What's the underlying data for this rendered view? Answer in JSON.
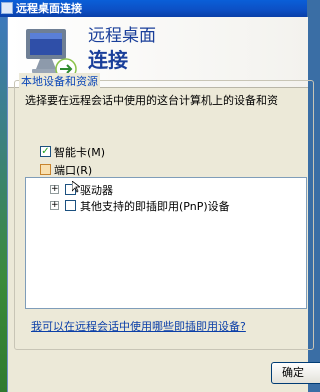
{
  "window": {
    "title": "远程桌面连接"
  },
  "banner": {
    "line1": "远程桌面",
    "line2": "连接"
  },
  "group": {
    "legend": "本地设备和资源",
    "description": "选择要在远程会话中使用的这台计算机上的设备和资"
  },
  "options": [
    {
      "label": "智能卡(M)",
      "checked": true
    },
    {
      "label": "端口(R)",
      "checked": false
    }
  ],
  "tree": [
    {
      "label": "驱动器",
      "expander": "+",
      "checked": false
    },
    {
      "label": "其他支持的即插即用(PnP)设备",
      "expander": "+",
      "checked": false
    }
  ],
  "link": "我可以在远程会话中使用哪些即插即用设备?",
  "buttons": {
    "ok": "确定"
  },
  "colors": {
    "titlebar": "#0a5fd8",
    "accent": "#0b47b8",
    "window_bg": "#ece9d8"
  }
}
